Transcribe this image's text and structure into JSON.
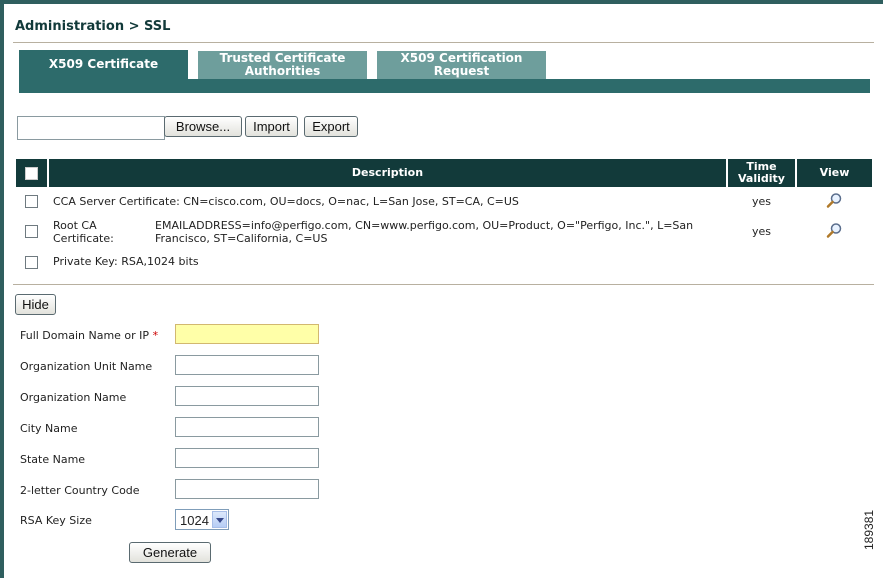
{
  "breadcrumb": "Administration > SSL",
  "tabs": [
    {
      "label": "X509 Certificate",
      "active": true
    },
    {
      "label": "Trusted Certificate Authorities",
      "active": false
    },
    {
      "label": "X509 Certification Request",
      "active": false
    }
  ],
  "toolbar": {
    "file_value": "",
    "browse_label": "Browse...",
    "import_label": "Import",
    "export_label": "Export"
  },
  "table": {
    "headers": {
      "description": "Description",
      "time_validity": "Time Validity",
      "view": "View"
    },
    "rows": [
      {
        "name": "",
        "description": "CCA Server Certificate: CN=cisco.com, OU=docs, O=nac, L=San Jose, ST=CA, C=US",
        "validity": "yes",
        "view_icon": "magnifier-icon"
      },
      {
        "name": "Root CA Certificate:",
        "description": "EMAILADDRESS=info@perfigo.com, CN=www.perfigo.com, OU=Product, O=\"Perfigo, Inc.\", L=San Francisco, ST=California, C=US",
        "validity": "yes",
        "view_icon": "magnifier-icon"
      },
      {
        "name": "",
        "description": "Private Key: RSA,1024 bits",
        "validity": "",
        "view_icon": ""
      }
    ]
  },
  "hide_label": "Hide",
  "form": {
    "fields": [
      {
        "label": "Full Domain Name or IP",
        "required_mark": "*",
        "value": ""
      },
      {
        "label": "Organization Unit Name",
        "value": ""
      },
      {
        "label": "Organization Name",
        "value": ""
      },
      {
        "label": "City Name",
        "value": ""
      },
      {
        "label": "State Name",
        "value": ""
      },
      {
        "label": "2-letter Country Code",
        "value": ""
      }
    ],
    "rsa_label": "RSA Key Size",
    "rsa_value": "1024",
    "generate_label": "Generate"
  },
  "figure_id": "189381",
  "colors": {
    "dark_teal": "#123a3a",
    "tab_active": "#2d6b6b",
    "tab_inactive": "#6e9e9c",
    "required_field": "#ffffa8"
  }
}
